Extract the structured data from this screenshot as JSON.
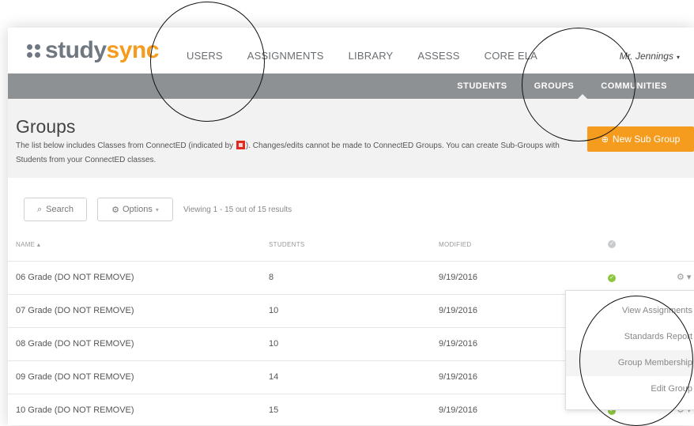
{
  "logo": {
    "part1": "study",
    "part2": "sync"
  },
  "main_nav": [
    "USERS",
    "ASSIGNMENTS",
    "LIBRARY",
    "ASSESS",
    "CORE ELA"
  ],
  "user": {
    "name": "Mr. Jennings",
    "caret": "▾"
  },
  "sub_nav": {
    "items": [
      "STUDENTS",
      "GROUPS",
      "COMMUNITIES"
    ],
    "active": "GROUPS"
  },
  "page": {
    "title": "Groups",
    "description_before": "The list below includes Classes from ConnectED (indicated by ",
    "description_after": "). Changes/edits cannot be made to ConnectED Groups. You can create Sub-Groups with Students from your ConnectED classes."
  },
  "new_button": {
    "icon": "⊕",
    "label": "New Sub Group"
  },
  "toolbar": {
    "search_label": "Search",
    "search_icon": "⌕",
    "options_icon": "⚙",
    "options_label": "Options",
    "options_caret": "▾",
    "viewing": "Viewing 1 - 15 out of 15 results"
  },
  "table": {
    "headers": {
      "name": "NAME ▴",
      "students": "STUDENTS",
      "modified": "MODIFIED"
    },
    "rows": [
      {
        "name": "06 Grade (DO NOT REMOVE)",
        "students": "8",
        "modified": "9/19/2016"
      },
      {
        "name": "07 Grade (DO NOT REMOVE)",
        "students": "10",
        "modified": "9/19/2016"
      },
      {
        "name": "08 Grade (DO NOT REMOVE)",
        "students": "10",
        "modified": "9/19/2016"
      },
      {
        "name": "09 Grade (DO NOT REMOVE)",
        "students": "14",
        "modified": "9/19/2016"
      },
      {
        "name": "10 Grade (DO NOT REMOVE)",
        "students": "15",
        "modified": "9/19/2016"
      }
    ]
  },
  "row_menu": [
    "View Assignments",
    "Standards Report",
    "Group Membership",
    "Edit Group"
  ],
  "colors": {
    "accent": "#f59b1d",
    "subnav_bg": "#8e9194",
    "check_green": "#8cc63f",
    "connected_red": "#e0291f"
  }
}
